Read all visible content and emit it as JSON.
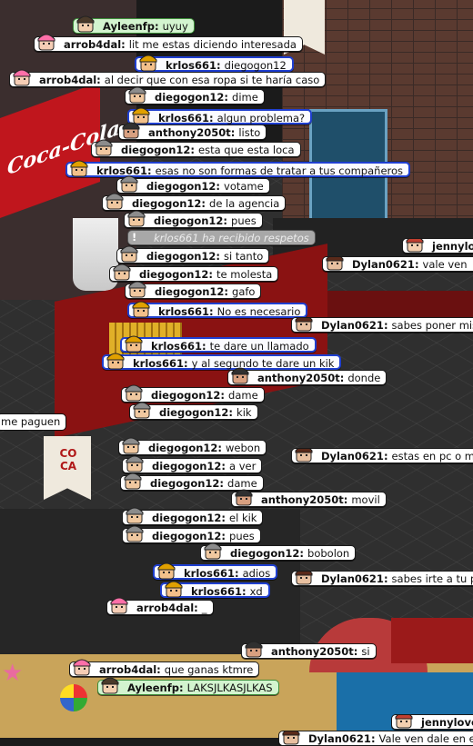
{
  "scene": {
    "sign_text": "Coca-Cola",
    "banner_text": "CO\nCA"
  },
  "chat": [
    {
      "id": "c1",
      "style": "green",
      "avatar": "ayleen-avatar",
      "name": "Ayleenfp:",
      "text": "uyuy"
    },
    {
      "id": "c2",
      "style": "normal",
      "avatar": "arrob-avatar",
      "name": "arrob4dal:",
      "text": "lit me estas diciendo interesada"
    },
    {
      "id": "c3",
      "style": "blue",
      "avatar": "krlos-avatar",
      "name": "krlos661:",
      "text": "diegogon12"
    },
    {
      "id": "c4",
      "style": "normal",
      "avatar": "arrob-avatar",
      "name": "arrob4dal:",
      "text": "al decir que con esa ropa si te haría caso"
    },
    {
      "id": "c5",
      "style": "normal",
      "avatar": "diego-avatar",
      "name": "diegogon12:",
      "text": "dime"
    },
    {
      "id": "c6",
      "style": "blue",
      "avatar": "krlos-avatar",
      "name": "krlos661:",
      "text": "algun problema?"
    },
    {
      "id": "c7",
      "style": "normal",
      "avatar": "anthony-avatar",
      "name": "anthony2050t:",
      "text": "listo"
    },
    {
      "id": "c8",
      "style": "normal",
      "avatar": "diego-avatar",
      "name": "diegogon12:",
      "text": "esta que esta loca"
    },
    {
      "id": "c9",
      "style": "blue",
      "avatar": "krlos-avatar",
      "name": "krlos661:",
      "text": "esas no son formas de tratar a tus compañeros"
    },
    {
      "id": "c10",
      "style": "normal",
      "avatar": "diego-avatar",
      "name": "diegogon12:",
      "text": "votame"
    },
    {
      "id": "c11",
      "style": "normal",
      "avatar": "diego-avatar",
      "name": "diegogon12:",
      "text": "de la agencia"
    },
    {
      "id": "c12",
      "style": "normal",
      "avatar": "diego-avatar",
      "name": "diegogon12:",
      "text": "pues"
    },
    {
      "id": "c13",
      "style": "gray",
      "avatar": "alert",
      "name": "",
      "text": "krlos661 ha recibido respetos"
    },
    {
      "id": "c14",
      "style": "normal",
      "avatar": "diego-avatar",
      "name": "diegogon12:",
      "text": "si tanto"
    },
    {
      "id": "c15",
      "style": "normal",
      "avatar": "diego-avatar",
      "name": "diegogon12:",
      "text": "te molesta"
    },
    {
      "id": "c16",
      "style": "normal",
      "avatar": "diego-avatar",
      "name": "diegogon12:",
      "text": "gafo"
    },
    {
      "id": "c17",
      "style": "blue",
      "avatar": "krlos-avatar",
      "name": "krlos661:",
      "text": "No es necesario"
    },
    {
      "id": "c18",
      "style": "blue",
      "avatar": "krlos-avatar",
      "name": "krlos661:",
      "text": "te dare un llamado"
    },
    {
      "id": "c19",
      "style": "blue",
      "avatar": "krlos-avatar",
      "name": "krlos661:",
      "text": "y al segundo te dare un kik"
    },
    {
      "id": "c20",
      "style": "normal",
      "avatar": "anthony-avatar",
      "name": "anthony2050t:",
      "text": "donde"
    },
    {
      "id": "c21",
      "style": "normal",
      "avatar": "diego-avatar",
      "name": "diegogon12:",
      "text": "dame"
    },
    {
      "id": "c22",
      "style": "normal",
      "avatar": "diego-avatar",
      "name": "diegogon12:",
      "text": "kik"
    },
    {
      "id": "c23",
      "style": "normal",
      "avatar": "diego-avatar",
      "name": "diegogon12:",
      "text": "webon"
    },
    {
      "id": "c24",
      "style": "normal",
      "avatar": "diego-avatar",
      "name": "diegogon12:",
      "text": "a ver"
    },
    {
      "id": "c25",
      "style": "normal",
      "avatar": "diego-avatar",
      "name": "diegogon12:",
      "text": "dame"
    },
    {
      "id": "c26",
      "style": "normal",
      "avatar": "anthony-avatar",
      "name": "anthony2050t:",
      "text": "movil"
    },
    {
      "id": "c27",
      "style": "normal",
      "avatar": "diego-avatar",
      "name": "diegogon12:",
      "text": "el kik"
    },
    {
      "id": "c28",
      "style": "normal",
      "avatar": "diego-avatar",
      "name": "diegogon12:",
      "text": "pues"
    },
    {
      "id": "c29",
      "style": "normal",
      "avatar": "diego-avatar",
      "name": "diegogon12:",
      "text": "bobolon"
    },
    {
      "id": "c30",
      "style": "blue",
      "avatar": "krlos-avatar",
      "name": "krlos661:",
      "text": "adios"
    },
    {
      "id": "c31",
      "style": "blue",
      "avatar": "krlos-avatar",
      "name": "krlos661:",
      "text": "xd"
    },
    {
      "id": "c32",
      "style": "normal",
      "avatar": "arrob-avatar",
      "name": "arrob4dal:",
      "text": "_"
    },
    {
      "id": "c33",
      "style": "normal",
      "avatar": "anthony-avatar",
      "name": "anthony2050t:",
      "text": "si"
    },
    {
      "id": "c34",
      "style": "normal",
      "avatar": "arrob-avatar",
      "name": "arrob4dal:",
      "text": "que ganas ktmre"
    },
    {
      "id": "c35",
      "style": "green",
      "avatar": "ayleen-avatar",
      "name": "Ayleenfp:",
      "text": "LAKSJLKASJLKAS"
    }
  ],
  "side_chat": [
    {
      "id": "s1",
      "avatar": "jenny-avatar",
      "name": "jennylove",
      "text": ""
    },
    {
      "id": "s2",
      "avatar": "dylan-avatar",
      "name": "Dylan0621:",
      "text": "vale ven"
    },
    {
      "id": "s3",
      "avatar": "dylan-avatar",
      "name": "Dylan0621:",
      "text": "sabes poner mision"
    },
    {
      "id": "s4",
      "avatar": "dylan-avatar",
      "name": "Dylan0621:",
      "text": "estas en pc o movil"
    },
    {
      "id": "s5",
      "avatar": "dylan-avatar",
      "name": "Dylan0621:",
      "text": "sabes irte a tu perfi"
    },
    {
      "id": "s6",
      "avatar": "jenny-avatar",
      "name": "jennylove",
      "text": ""
    },
    {
      "id": "s7",
      "avatar": "dylan-avatar",
      "name": "Dylan0621:",
      "text": "Vale ven dale en el li"
    }
  ],
  "left_chat": [
    {
      "id": "l1",
      "name": "",
      "text": "me paguen"
    }
  ]
}
